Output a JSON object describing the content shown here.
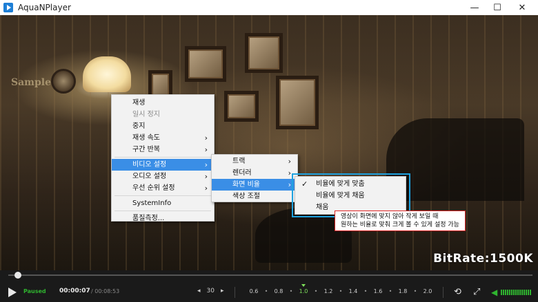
{
  "window": {
    "title": "AquaNPlayer",
    "minimize": "—",
    "maximize": "☐",
    "close": "✕"
  },
  "video": {
    "watermark": "Sample",
    "bitrate": "BitRate:1500K"
  },
  "context_menu": {
    "items": [
      {
        "label": "재생"
      },
      {
        "label": "일시 정지"
      },
      {
        "label": "중지"
      },
      {
        "label": "재생 속도"
      },
      {
        "label": "구간 반복"
      },
      {
        "label": "비디오 설정"
      },
      {
        "label": "오디오 설정"
      },
      {
        "label": "우선 순위 설정"
      },
      {
        "label": "SystemInfo"
      },
      {
        "label": "품질측정..."
      }
    ]
  },
  "video_submenu": {
    "items": [
      {
        "label": "트랙"
      },
      {
        "label": "렌더러"
      },
      {
        "label": "화면 비율"
      },
      {
        "label": "색상 조절"
      }
    ]
  },
  "ratio_submenu": {
    "items": [
      {
        "label": "비율에 맞게 맞춤"
      },
      {
        "label": "비율에 맞게 채움"
      },
      {
        "label": "채움"
      }
    ]
  },
  "tooltip": {
    "line1": "영상이 화면에 맞지 않아 작게 보일 때",
    "line2": "원하는 비율로 맞춰 크게 볼 수 있게 설정 가능"
  },
  "controls": {
    "status": "Paused",
    "current_time": "00:00:07",
    "duration": "/ 00:08:53",
    "skip_seconds": "30",
    "speeds": [
      "0.6",
      "0.8",
      "1.0",
      "1.2",
      "1.4",
      "1.6",
      "1.8",
      "2.0"
    ],
    "active_speed": "1.0",
    "progress_fraction": 0.013
  },
  "colors": {
    "menu_highlight": "#3a8ee6",
    "callout_border": "#1ea2e0",
    "tooltip_border": "#dd2222",
    "accent_green": "#2fb52f"
  }
}
